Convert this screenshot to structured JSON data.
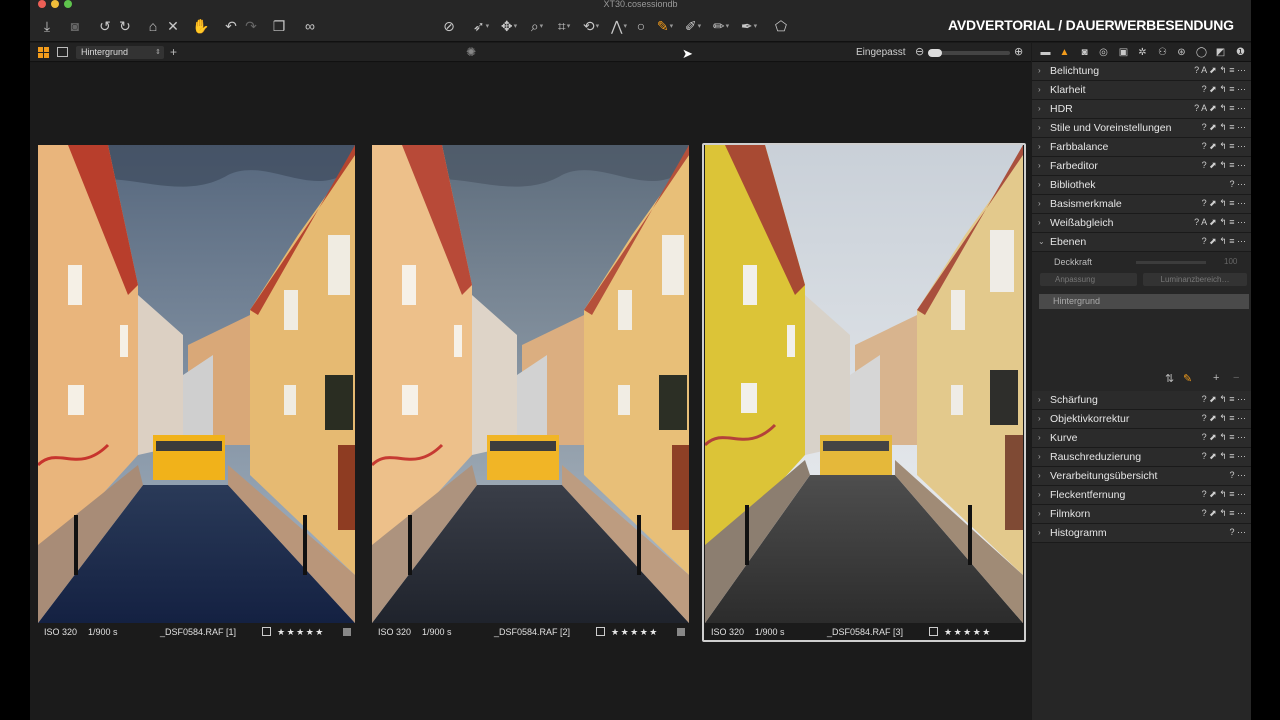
{
  "window": {
    "title": "XT30.cosessiondb"
  },
  "watermark": "AVDVERTORIAL / DAUERWERBESENDUNG",
  "subbar": {
    "layer_select": "Hintergrund",
    "fit_label": "Eingepasst"
  },
  "photos": [
    {
      "iso": "ISO 320",
      "shutter": "1/900 s",
      "filename": "_DSF0584.RAF [1]",
      "rating": "★★★★★",
      "selected": false
    },
    {
      "iso": "ISO 320",
      "shutter": "1/900 s",
      "filename": "_DSF0584.RAF [2]",
      "rating": "★★★★★",
      "selected": false
    },
    {
      "iso": "ISO 320",
      "shutter": "1/900 s",
      "filename": "_DSF0584.RAF [3]",
      "rating": "★★★★★",
      "selected": true
    }
  ],
  "panel": {
    "tools": [
      {
        "label": "Belichtung",
        "icons": "? A ⬈ ↰ ≡ ···"
      },
      {
        "label": "Klarheit",
        "icons": "? ⬈ ↰ ≡ ···"
      },
      {
        "label": "HDR",
        "icons": "? A ⬈ ↰ ≡ ···"
      },
      {
        "label": "Stile und Voreinstellungen",
        "icons": "? ⬈ ↰ ≡ ···"
      },
      {
        "label": "Farbbalance",
        "icons": "? ⬈ ↰ ≡ ···"
      },
      {
        "label": "Farbeditor",
        "icons": "? ⬈ ↰ ≡ ···"
      },
      {
        "label": "Bibliothek",
        "icons": "? ···"
      },
      {
        "label": "Basismerkmale",
        "icons": "? ⬈ ↰ ≡ ···"
      },
      {
        "label": "Weißabgleich",
        "icons": "? A ⬈ ↰ ≡ ···"
      },
      {
        "label": "Ebenen",
        "icons": "? ⬈ ↰ ≡ ···"
      }
    ],
    "layers": {
      "opacity_label": "Deckkraft",
      "opacity_value": "100",
      "adjust_button": "Anpassung",
      "luminance_button": "Luminanzbereich…",
      "layer_name": "Hintergrund"
    },
    "tools_lower": [
      {
        "label": "Schärfung",
        "icons": "? ⬈ ↰ ≡ ···"
      },
      {
        "label": "Objektivkorrektur",
        "icons": "? ⬈ ↰ ≡ ···"
      },
      {
        "label": "Kurve",
        "icons": "? ⬈ ↰ ≡ ···"
      },
      {
        "label": "Rauschreduzierung",
        "icons": "? ⬈ ↰ ≡ ···"
      },
      {
        "label": "Verarbeitungsübersicht",
        "icons": "? ···"
      },
      {
        "label": "Fleckentfernung",
        "icons": "? ⬈ ↰ ≡ ···"
      },
      {
        "label": "Filmkorn",
        "icons": "? ⬈ ↰ ≡ ···"
      },
      {
        "label": "Histogramm",
        "icons": "? ···"
      }
    ]
  },
  "colors": {
    "accent": "#f39c1b",
    "bg": "#1a1a1a",
    "panel": "#272727"
  }
}
